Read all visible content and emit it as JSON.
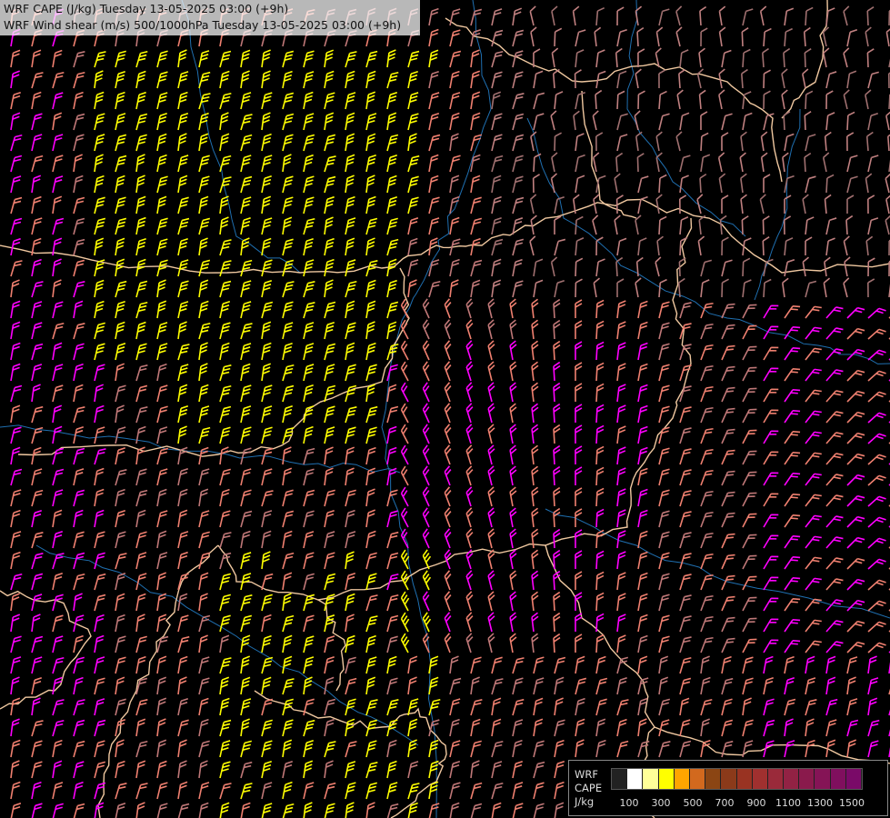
{
  "title": {
    "line1": "WRF CAPE (J/kg) Tuesday 13-05-2025 03:00 (+9h)",
    "line2": "WRF Wind shear (m/s) 500/1000hPa Tuesday 13-05-2025 03:00 (+9h)"
  },
  "legend": {
    "label_wrf": "WRF",
    "label_cape": "CAPE",
    "label_unit": "J/kg",
    "ticks": [
      "100",
      "300",
      "500",
      "700",
      "900",
      "1100",
      "1300",
      "1500"
    ],
    "colors": [
      "#222222",
      "#ffffff",
      "#ffff99",
      "#ffff00",
      "#ffa500",
      "#d2691e",
      "#8b4513",
      "#8b3a1a",
      "#993322",
      "#a0302f",
      "#9a2a3a",
      "#922244",
      "#8a1a4c",
      "#851456",
      "#800f5e",
      "#7a0a68"
    ]
  },
  "map_colors": {
    "background": "#000000",
    "border": "#f0c8a0",
    "river": "#1f6fb0",
    "barb_yellow": "#ffff00",
    "barb_salmon": "#f08070",
    "barb_magenta": "#ff00ff",
    "barb_rose": "#c07878"
  }
}
